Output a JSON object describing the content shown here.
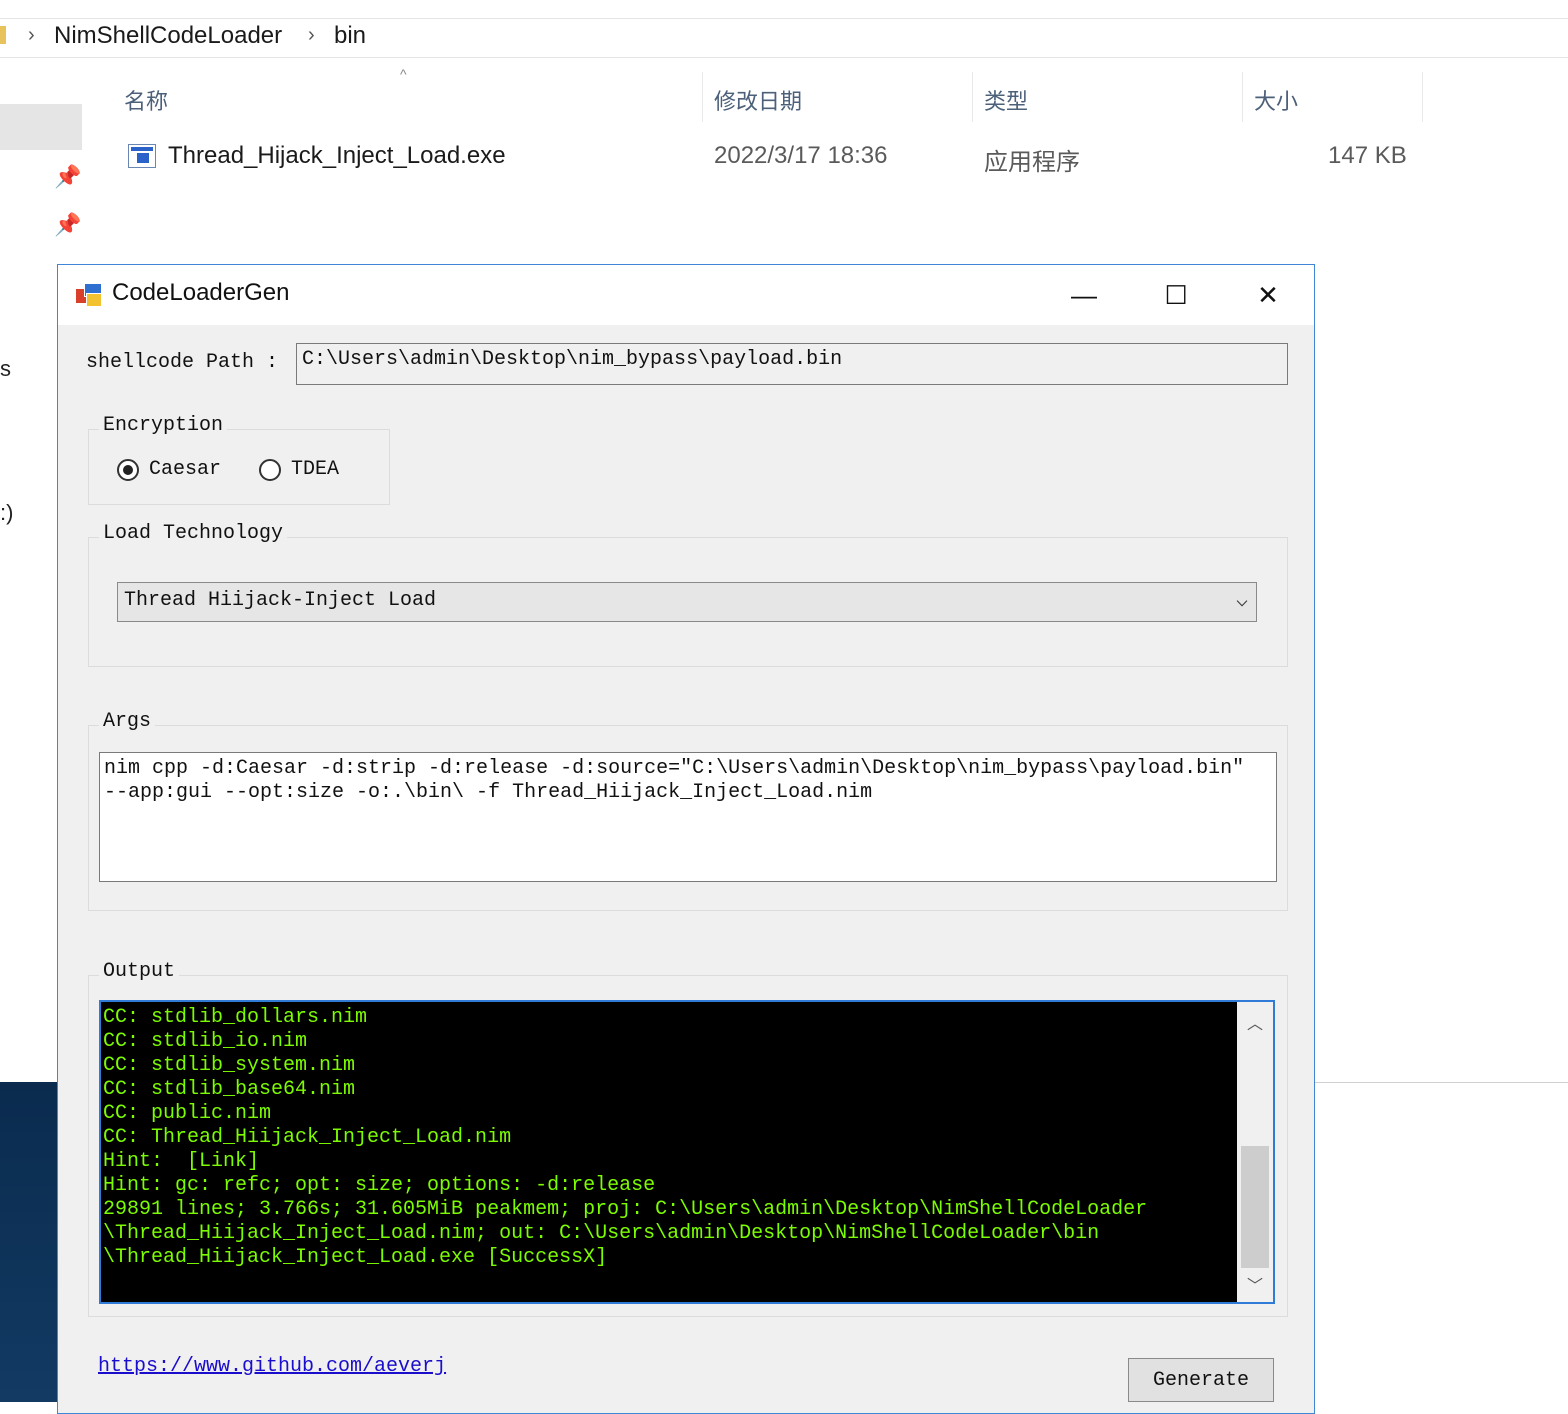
{
  "explorer": {
    "breadcrumb": [
      "NimShellCodeLoader",
      "bin"
    ],
    "separator": "›",
    "columns": {
      "name": "名称",
      "date": "修改日期",
      "type": "类型",
      "size": "大小"
    },
    "file": {
      "name": "Thread_Hijack_Inject_Load.exe",
      "date": "2022/3/17 18:36",
      "type": "应用程序",
      "size": "147 KB"
    },
    "edge_chars": [
      "s",
      ":)"
    ]
  },
  "app": {
    "title": "CodeLoaderGen",
    "controls": {
      "minimize": "—",
      "maximize": "☐",
      "close": "✕"
    },
    "shellcode_label": "shellcode Path :",
    "shellcode_path": "C:\\Users\\admin\\Desktop\\nim_bypass\\payload.bin",
    "encryption": {
      "title": "Encryption",
      "options": [
        "Caesar",
        "TDEA"
      ],
      "selected": "Caesar"
    },
    "load_technology": {
      "title": "Load Technology",
      "selected": "Thread Hiijack-Inject Load"
    },
    "args": {
      "title": "Args",
      "text": "nim cpp -d:Caesar -d:strip -d:release -d:source=\"C:\\Users\\admin\\Desktop\\nim_bypass\\payload.bin\"\n--app:gui --opt:size -o:.\\bin\\ -f Thread_Hiijack_Inject_Load.nim"
    },
    "output": {
      "title": "Output",
      "text": "CC: stdlib_dollars.nim\nCC: stdlib_io.nim\nCC: stdlib_system.nim\nCC: stdlib_base64.nim\nCC: public.nim\nCC: Thread_Hiijack_Inject_Load.nim\nHint:  [Link]\nHint: gc: refc; opt: size; options: -d:release\n29891 lines; 3.766s; 31.605MiB peakmem; proj: C:\\Users\\admin\\Desktop\\NimShellCodeLoader\n\\Thread_Hiijack_Inject_Load.nim; out: C:\\Users\\admin\\Desktop\\NimShellCodeLoader\\bin\n\\Thread_Hiijack_Inject_Load.exe [SuccessX]"
    },
    "link": "https://www.github.com/aeverj",
    "generate_label": "Generate",
    "colors": {
      "accent": "#3f86d6",
      "console_text": "#7cfc00",
      "link": "#1a0dcc"
    }
  }
}
